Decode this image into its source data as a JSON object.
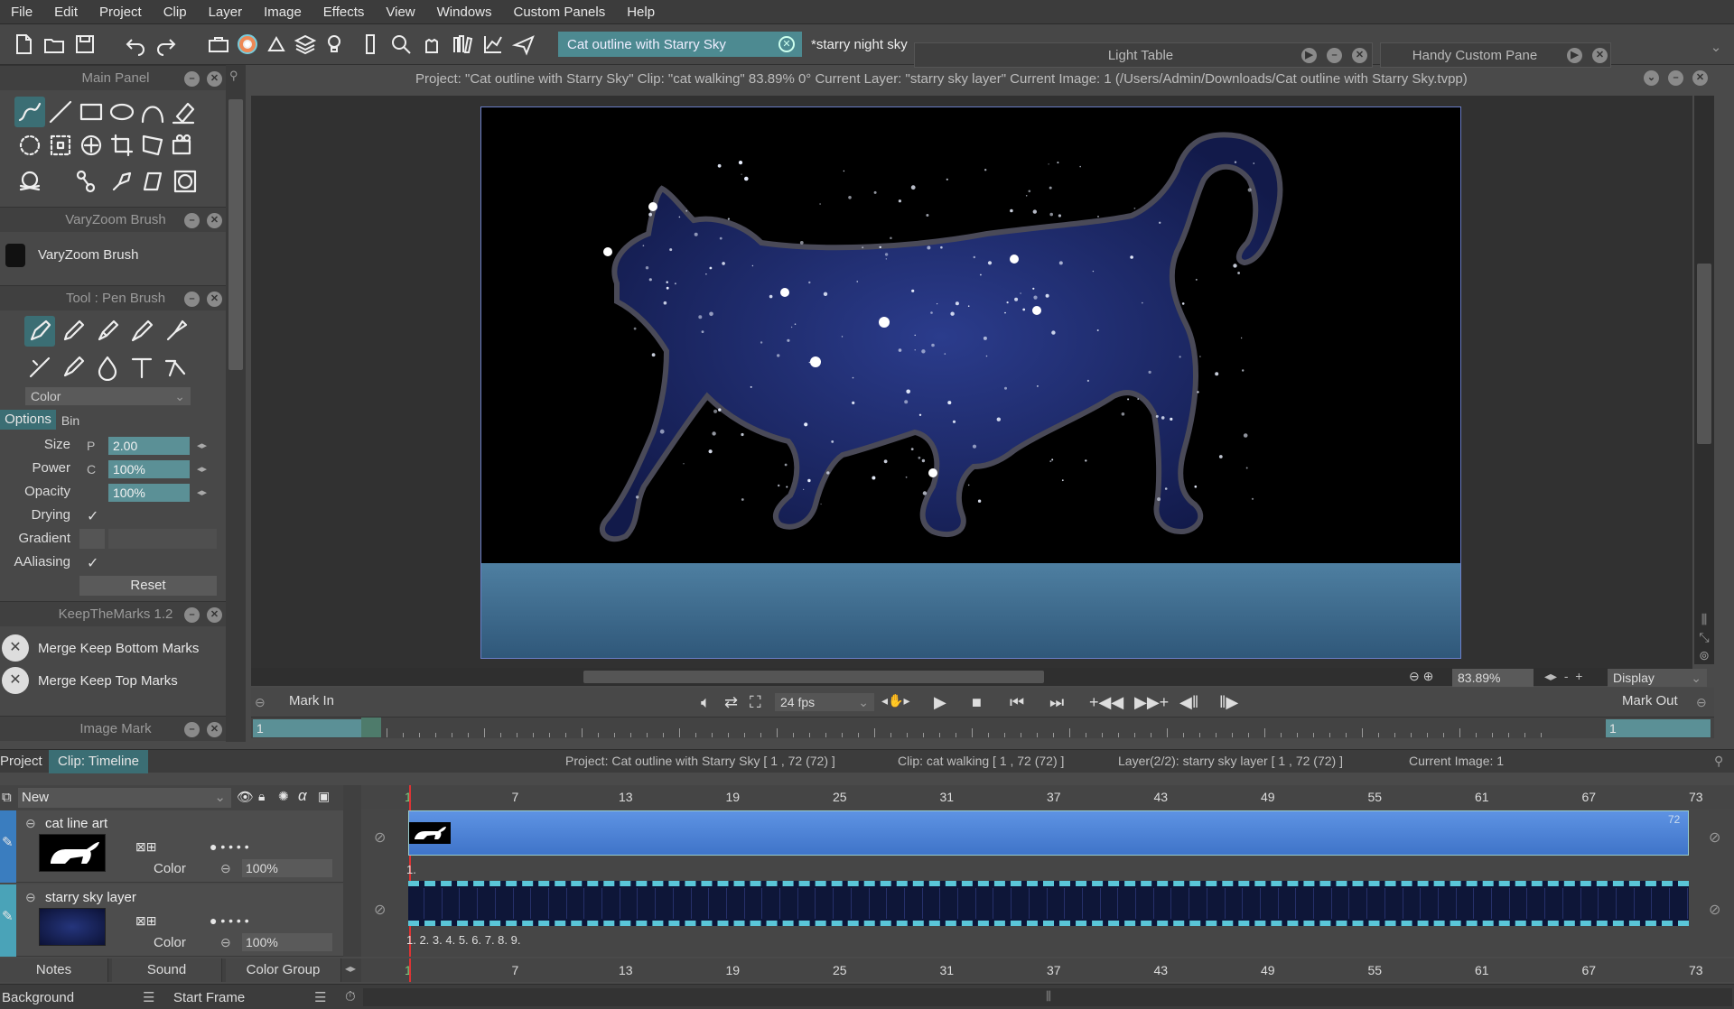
{
  "menu": [
    "File",
    "Edit",
    "Project",
    "Clip",
    "Layer",
    "Image",
    "Effects",
    "View",
    "Windows",
    "Custom Panels",
    "Help"
  ],
  "tabs": {
    "active": "Cat outline with Starry Sky",
    "second": "*starry night sky"
  },
  "floating": {
    "light_table": "Light Table",
    "handy": "Handy Custom Pane"
  },
  "info_bar": "Project:  \"Cat outline with Starry Sky\"  Clip: \"cat walking\"   83.89%   0°  Current Layer: \"starry sky layer\"  Current Image: 1 (/Users/Admin/Downloads/Cat outline with Starry Sky.tvpp)",
  "panels": {
    "main": "Main Panel",
    "vary": "VaryZoom Brush",
    "vary_item": "VaryZoom Brush",
    "tool": "Tool : Pen Brush",
    "color_select": "Color",
    "options_tab": "Options",
    "bin_tab": "Bin",
    "keep": "KeepTheMarks 1.2",
    "keep_bottom": "Merge Keep Bottom Marks",
    "keep_top": "Merge Keep Top Marks",
    "image_mark": "Image Mark"
  },
  "props": {
    "size_label": "Size",
    "size_prefix": "P",
    "size_value": "2.00",
    "power_label": "Power",
    "power_prefix": "C",
    "power_value": "100%",
    "opacity_label": "Opacity",
    "opacity_value": "100%",
    "drying_label": "Drying",
    "gradient_label": "Gradient",
    "aaliasing_label": "AAliasing",
    "reset": "Reset"
  },
  "transport": {
    "mark_in": "Mark In",
    "mark_out": "Mark Out",
    "fps": "24 fps",
    "zoom": "83.89%",
    "display": "Display",
    "in_value": "1",
    "out_value": "1"
  },
  "timeline": {
    "project_tab": "Project",
    "clip_tab": "Clip: Timeline",
    "info_project": "Project: Cat outline with Starry Sky [ 1 , 72  (72) ]",
    "info_clip": "Clip: cat walking [ 1 , 72  (72) ]",
    "info_layer": "Layer(2/2): starry sky layer [ 1 , 72  (72) ]",
    "info_image": "Current Image: 1",
    "new_label": "New",
    "ruler": [
      "1",
      "7",
      "13",
      "19",
      "25",
      "31",
      "37",
      "43",
      "49",
      "55",
      "61",
      "67",
      "73"
    ],
    "end_frame": "72",
    "layer1_first_frame": "1.",
    "layer2_frames": "1.  2.  3.  4.  5.  6.  7.  8.  9.",
    "layers": [
      {
        "name": "cat line art",
        "mode": "Color",
        "opacity": "100%"
      },
      {
        "name": "starry sky layer",
        "mode": "Color",
        "opacity": "100%"
      }
    ]
  },
  "bottom_tabs": {
    "notes": "Notes",
    "sound": "Sound",
    "color_group": "Color Group"
  },
  "status": {
    "background": "Background",
    "start_frame": "Start Frame"
  },
  "colors": {
    "accent": "#4d8a91",
    "layer_blue": "#3f74c9",
    "canvas_border": "#6b7ec8"
  }
}
